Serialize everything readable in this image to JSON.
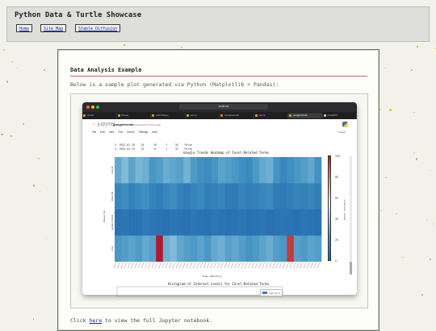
{
  "site": {
    "title": "Python Data & Turtle Showcase",
    "nav": [
      "Home",
      "Site Map",
      "Stable Diffusion"
    ]
  },
  "card": {
    "title": "Data Analysis Example",
    "description": "Below is a sample plot generated via Python (Matplotlib + Pandas):",
    "footer_before": "Click ",
    "footer_link": "here",
    "footer_after": " to view the full Jupyter notebook."
  },
  "browser": {
    "url": "localhost",
    "tabs": [
      {
        "label": "Orose",
        "color": "#e0a030"
      },
      {
        "label": "Roese",
        "color": "#e0a030"
      },
      {
        "label": "orderShops",
        "color": "#e0a030"
      },
      {
        "label": "Home",
        "color": "#e0a030"
      },
      {
        "label": "Googletrends",
        "color": "#f37726"
      },
      {
        "label": "Home",
        "color": "#e0a030"
      },
      {
        "label": "googletrends",
        "color": "#e0a030",
        "active": true
      },
      {
        "label": "ChatGPT",
        "color": "#cccccc"
      }
    ]
  },
  "jupyter": {
    "logo": "jupyter",
    "notebook_name": "googletrends",
    "checkpoint": "Last Checkpoint: 8 hours ago",
    "menu": [
      "File",
      "Edit",
      "View",
      "Run",
      "Kernel",
      "Settings",
      "Help"
    ],
    "trusted": "Trusted",
    "df_rows": [
      "3  2022-01-16    24      10      1     34    False",
      "4  2022-01-23    22      11      1     32    False"
    ]
  },
  "chart_data": [
    {
      "type": "heatmap",
      "title": "Google Trends Heatmap of Incel-Related Terms",
      "xlabel": "Time (Monthly)",
      "ylabel": "Keywords",
      "rows": [
        "red pill",
        "black pill",
        "gender critical",
        "incel"
      ],
      "colorbar": {
        "label": "Interest Level",
        "ticks": [
          0,
          20,
          40,
          60,
          80,
          100
        ],
        "colormap": [
          "#2166ac",
          "#4393c3",
          "#92c5de",
          "#f7f7f7",
          "#f4a582",
          "#d6604d",
          "#b2182b"
        ]
      },
      "values_note": "",
      "row_levels": {
        "red pill": [
          24,
          30,
          22,
          28,
          26,
          18,
          20,
          25,
          23,
          21,
          27,
          19,
          16,
          14,
          17,
          22,
          20,
          18,
          15,
          13,
          19,
          24,
          26,
          17,
          12,
          15,
          18,
          20,
          23,
          16
        ],
        "black pill": [
          12,
          14,
          10,
          13,
          15,
          11,
          9,
          12,
          14,
          10,
          8,
          11,
          13,
          9,
          10,
          12,
          8,
          7,
          11,
          9,
          10,
          12,
          13,
          8,
          7,
          9,
          11,
          10,
          12,
          9
        ],
        "gender critical": [
          5,
          6,
          4,
          5,
          7,
          6,
          5,
          4,
          6,
          5,
          4,
          6,
          5,
          4,
          6,
          5,
          4,
          5,
          6,
          4,
          5,
          6,
          4,
          5,
          6,
          5,
          4,
          6,
          5,
          4
        ],
        "incel": [
          18,
          20,
          22,
          19,
          24,
          21,
          100,
          26,
          30,
          23,
          20,
          19,
          22,
          18,
          24,
          26,
          21,
          23,
          20,
          17,
          19,
          22,
          25,
          20,
          18,
          92,
          21,
          19,
          22,
          20
        ]
      }
    },
    {
      "type": "bar",
      "title": "Histogram of Interest Levels for Incel-Related Terms",
      "series": [
        {
          "name": "red pill"
        }
      ]
    }
  ]
}
